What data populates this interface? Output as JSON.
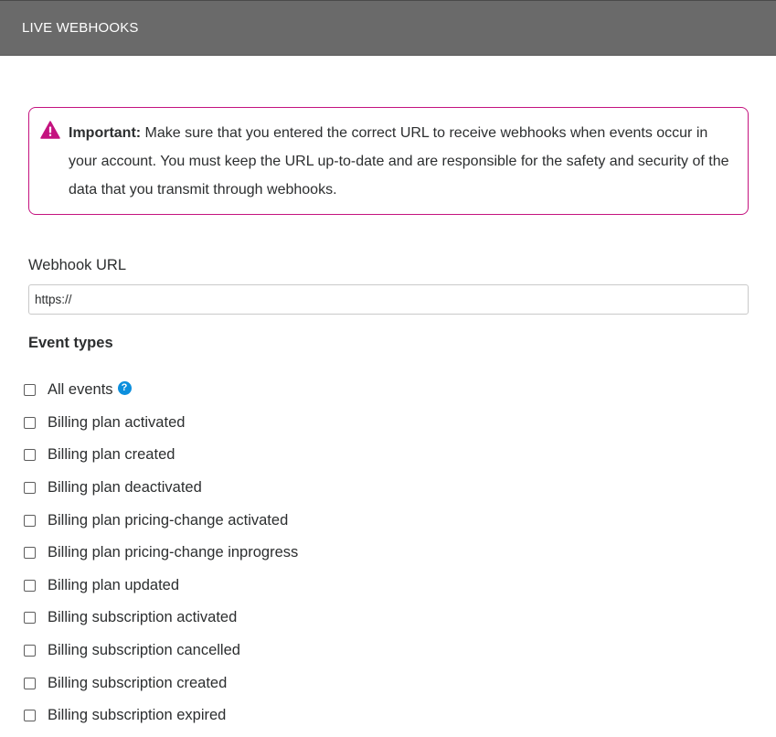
{
  "header": {
    "title": "LIVE WEBHOOKS",
    "background_color": "#6a6a6a"
  },
  "alert": {
    "icon": "warning-triangle-icon",
    "accent_color": "#c4137f",
    "strong_label": "Important:",
    "message": " Make sure that you entered the correct URL to receive webhooks when events occur in your account. You must keep the URL up-to-date and are responsible for the safety and security of the data that you transmit through webhooks."
  },
  "webhook_url": {
    "label": "Webhook URL",
    "value": "https://"
  },
  "event_types": {
    "title": "Event types",
    "help_icon": "question-circle-icon",
    "help_glyph": "?",
    "help_color": "#0c8fdd",
    "items": [
      {
        "label": "All events",
        "checked": false
      },
      {
        "label": "Billing plan activated",
        "checked": false
      },
      {
        "label": "Billing plan created",
        "checked": false
      },
      {
        "label": "Billing plan deactivated",
        "checked": false
      },
      {
        "label": "Billing plan pricing-change activated",
        "checked": false
      },
      {
        "label": "Billing plan pricing-change inprogress",
        "checked": false
      },
      {
        "label": "Billing plan updated",
        "checked": false
      },
      {
        "label": "Billing subscription activated",
        "checked": false
      },
      {
        "label": "Billing subscription cancelled",
        "checked": false
      },
      {
        "label": "Billing subscription created",
        "checked": false
      },
      {
        "label": "Billing subscription expired",
        "checked": false
      }
    ]
  }
}
